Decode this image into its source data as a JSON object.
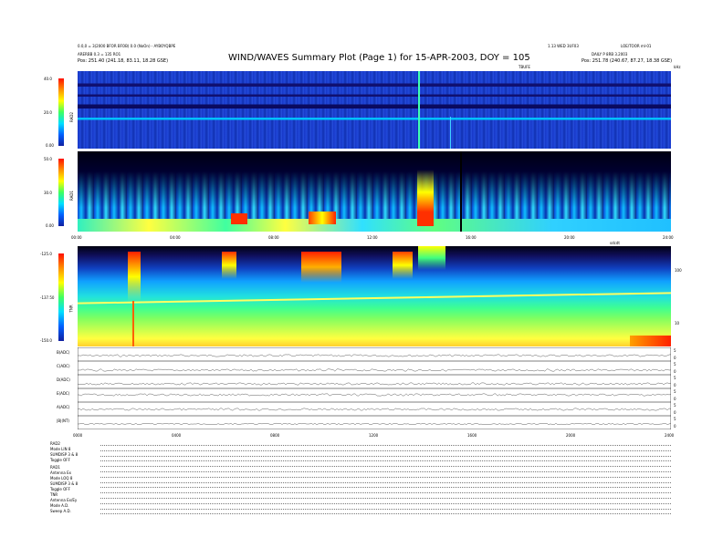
{
  "title": "WIND/WAVES Summary Plot (Page 1) for 15-APR-2003, DOY = 105",
  "header_left": {
    "line1": "0.0,0 = 3(2000 BFOR BFOB) 0.0 (NoOn) - AYBOYQBPE",
    "line2": "ARERBB 0.3 = 135 RO1",
    "pos": "Pos:   251.40 (241.18, 83.11, 18.28 GSE)"
  },
  "header_right": {
    "line1": "1.13 WED 3UF03",
    "line2": "LOE/TOOR ml-01",
    "line3": "DAILY P 8RB 3.2003",
    "pos": "Pos:   251.78 (240.67, 87.27, 18.38 GSE)"
  },
  "top_time_label": "TBUFE",
  "right_corner_label": "kHz",
  "panels": {
    "rad2": {
      "label": "RAD2",
      "ticks": [
        "40.0",
        "20.0",
        "0.00"
      ]
    },
    "rad1": {
      "label": "RAD1",
      "ticks": [
        "50.0",
        "30.0",
        "0.00"
      ]
    },
    "tnr": {
      "label": "TNR",
      "ticks": [
        "-125.0",
        "-137.50",
        "-150.0"
      ],
      "right_ticks": [
        "100",
        "10"
      ],
      "top_right_label": "sdcdt"
    }
  },
  "time_axis": [
    "00:00",
    "04:00",
    "08:00",
    "12:00",
    "16:00",
    "20:00",
    "24:00"
  ],
  "bottom_axis": [
    "0000",
    "0400",
    "0800",
    "1200",
    "1600",
    "2000",
    "2400"
  ],
  "lines": [
    {
      "label": "B(ADC)",
      "right": [
        "5",
        "0"
      ]
    },
    {
      "label": "C(ADC)",
      "right": [
        "5",
        "0"
      ]
    },
    {
      "label": "D(ADC)",
      "right": [
        "5",
        "0"
      ]
    },
    {
      "label": "E(ADC)",
      "right": [
        "5",
        "0"
      ]
    },
    {
      "label": "A(ADC)",
      "right": [
        "5",
        "0"
      ]
    },
    {
      "label": "|B|(NT)",
      "right": [
        "5",
        "0"
      ]
    }
  ],
  "footer": {
    "rad2": [
      "RAD2",
      "Mode   LIN 8",
      "SUMDISP 3 & 8",
      "Toggle   OFF"
    ],
    "rad1": [
      "RAD1",
      "Antenna     Ex",
      "Mode  LOQ 8",
      "SUMDISP 3 & 8",
      "Toggle   OFF"
    ],
    "tnr": [
      "TNR",
      "Antenna   Ex/Ey",
      "Mode     A.D.",
      "Sweep     A.D."
    ]
  },
  "colors": {
    "bg_dark": "#101080",
    "bg_blue": "#1030c0",
    "cyan": "#00e0ff",
    "green": "#40ff60",
    "yellow": "#ffff00",
    "red": "#ff2000"
  }
}
